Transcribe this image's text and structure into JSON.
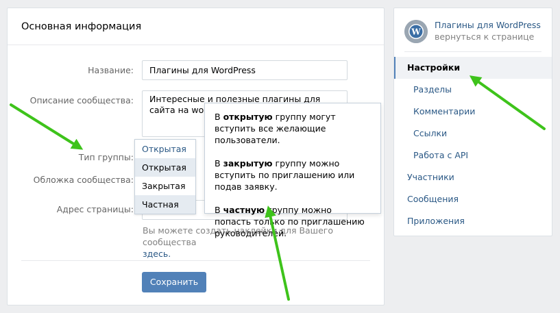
{
  "main": {
    "title": "Основная информация",
    "name_label": "Название:",
    "name_value": "Плагины для WordPress",
    "desc_label": "Описание сообщества:",
    "desc_value": "Интересные и полезные плагины для сайта на wordpress, настройке.",
    "type_label": "Тип группы:",
    "cover_label": "Обложка сообщества:",
    "address_label": "Адрес страницы:",
    "hint_text": "Вы можете создать наклейки для Вашего сообщества",
    "hint_link": "здесь.",
    "save_label": "Сохранить"
  },
  "type_dropdown": {
    "selected": "Открытая",
    "options": [
      "Открытая",
      "Закрытая",
      "Частная"
    ]
  },
  "tooltip": {
    "p1_pre": "В ",
    "p1_bold": "открытую",
    "p1_post": " группу могут вступить все желающие пользователи.",
    "p2_pre": "В ",
    "p2_bold": "закрытую",
    "p2_post": " группу можно вступить по приглашению или подав заявку.",
    "p3_pre": "В ",
    "p3_bold": "частную",
    "p3_post": " группу можно попасть только по приглашению руководителей."
  },
  "sidebar": {
    "community_name": "Плагины для WordPress",
    "back_link": "вернуться к странице",
    "items": [
      {
        "label": "Настройки"
      },
      {
        "label": "Разделы"
      },
      {
        "label": "Комментарии"
      },
      {
        "label": "Ссылки"
      },
      {
        "label": "Работа с API"
      },
      {
        "label": "Участники"
      },
      {
        "label": "Сообщения"
      },
      {
        "label": "Приложения"
      }
    ]
  },
  "colors": {
    "accent": "#5181b8",
    "link": "#2a5885",
    "arrow": "#3ec31b",
    "background": "#edeef0"
  },
  "icons": {
    "avatar": "wordpress-logo-icon"
  }
}
